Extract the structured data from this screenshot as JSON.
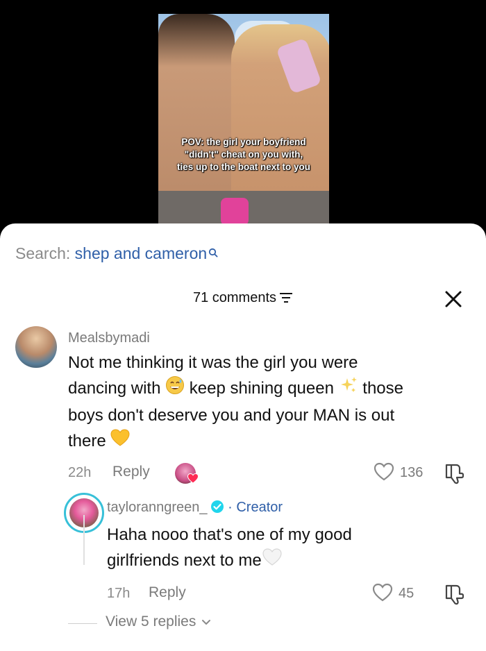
{
  "video": {
    "caption_lines": [
      "POV: the girl your boyfriend",
      "\"didn't\" cheat on you with,",
      "ties up to the boat next to you"
    ]
  },
  "search": {
    "label": "Search:",
    "term": "shep and cameron"
  },
  "comments_header": {
    "count_text": "71 comments"
  },
  "comments": [
    {
      "username": "Mealsbymadi",
      "text_lines": [
        "Not me thinking it was the girl you were",
        "dancing with",
        "keep shining queen",
        "those",
        "boys don't deserve you and your MAN is out",
        "there"
      ],
      "time": "22h",
      "reply_label": "Reply",
      "likes": "136"
    },
    {
      "username": "tayloranngreen_",
      "creator_label": "· Creator",
      "text_lines": [
        "Haha nooo that's one of my good",
        "girlfriends next to me"
      ],
      "time": "17h",
      "reply_label": "Reply",
      "likes": "45"
    }
  ],
  "view_replies": "View 5 replies",
  "colors": {
    "link": "#2f5fa8",
    "verified": "#20d5ec",
    "heart_red": "#fe2c55"
  }
}
